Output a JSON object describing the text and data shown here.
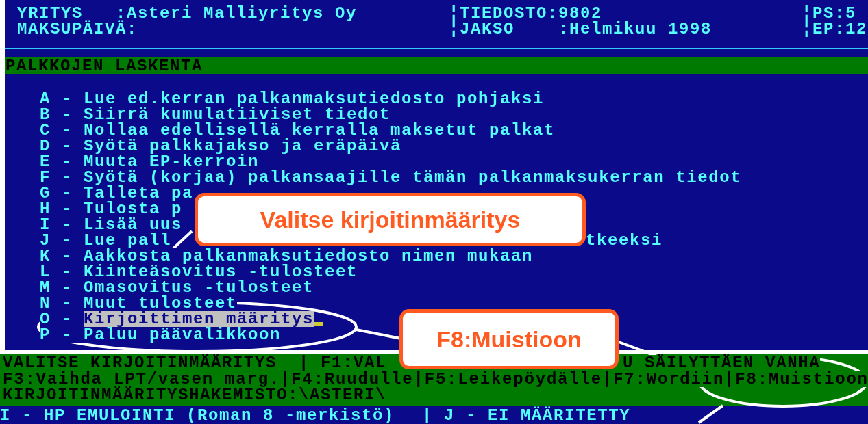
{
  "header": {
    "left": [
      "YRITYS   :Asteri Malliyritys Oy",
      "MAKSUPÄIVÄ:"
    ],
    "middle": [
      "¦TIEDOSTO:9802",
      "¦JAKSO    :Helmikuu 1998"
    ],
    "right": [
      "¦PS:5",
      "¦EP:12"
    ]
  },
  "section_title": "PALKKOJEN LASKENTA",
  "menu": [
    {
      "key": "A - ",
      "label": "Lue ed.kerran palkanmaksutiedosto pohjaksi",
      "selected": false
    },
    {
      "key": "B - ",
      "label": "Siirrä kumulatiiviset tiedot",
      "selected": false
    },
    {
      "key": "C - ",
      "label": "Nollaa edellisellä kerralla maksetut palkat",
      "selected": false
    },
    {
      "key": "D - ",
      "label": "Syötä palkkajakso ja eräpäivä",
      "selected": false
    },
    {
      "key": "E - ",
      "label": "Muuta EP-kerroin",
      "selected": false
    },
    {
      "key": "F - ",
      "label": "Syötä (korjaa) palkansaajille tämän palkanmaksukerran tiedot",
      "selected": false
    },
    {
      "key": "G - ",
      "label": "Talleta pa",
      "selected": false
    },
    {
      "key": "H - ",
      "label": "Tulosta p",
      "selected": false
    },
    {
      "key": "I - ",
      "label": "Lisää uus",
      "selected": false
    },
    {
      "key": "J - ",
      "label": "Lue pall",
      "tail": "tkeeksi",
      "selected": false
    },
    {
      "key": "K - ",
      "label": "Aakkosta palkanmaksutiedosto nimen mukaan",
      "selected": false
    },
    {
      "key": "L - ",
      "label": "Kiinteäsovitus -tulosteet",
      "selected": false
    },
    {
      "key": "M - ",
      "label": "Omasovitus -tulosteet",
      "selected": false
    },
    {
      "key": "N - ",
      "label": "Muut tulosteet",
      "selected": false
    },
    {
      "key": "O - ",
      "label": "Kirjoittimen määritys",
      "selected": true
    },
    {
      "key": "P - ",
      "label": "Paluu päävalikkoon",
      "selected": false
    }
  ],
  "help_bar": {
    "line_1": [
      "VALITSE KIRJOITINMÄÄRITYS  | F1:VAL",
      "U SÄILYTTÄEN VANHA"
    ],
    "line_2": "F3:Vaihda LPT/vasen marg.|F4:Ruudulle|F5:Leikepöydälle|F7:Wordiin|F8:Muistioon",
    "line_3": "KIRJOITINMÄÄRITYSHAKEMISTO:\\ASTERI\\"
  },
  "printer_row": [
    "I - HP EMULOINTI (Roman 8 -merkistö)",
    "| J - EI MÄÄRITETTY"
  ],
  "callouts": [
    "Valitse kirjoitinmääritys",
    "F8:Muistioon"
  ]
}
